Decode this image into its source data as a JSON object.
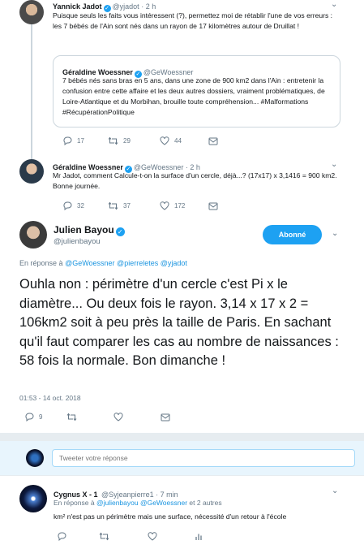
{
  "tweet1": {
    "name": "Yannick Jadot",
    "handle": "@yjadot",
    "time": "2 h",
    "text": "Puisque seuls les faits vous intéressent (?), permettez moi de rétablir l'une de vos erreurs : les 7 bébés de l'Ain sont nés dans un rayon de 17 kilomètres autour de Druillat !",
    "quote": {
      "name": "Géraldine Woessner",
      "handle": "@GeWoessner",
      "text": "7 bébés nés sans bras en 5 ans, dans une zone de 900 km2 dans l'Ain : entretenir la confusion entre cette affaire et les deux autres dossiers, vraiment problématiques, de Loire-Atlantique et du Morbihan, brouille toute compréhension... #Malformations #RécupérationPolitique"
    },
    "replies": "17",
    "retweets": "29",
    "likes": "44"
  },
  "tweet2": {
    "name": "Géraldine Woessner",
    "handle": "@GeWoessner",
    "time": "2 h",
    "text": "Mr Jadot, comment Calcule-t-on la surface d'un cercle, déjà...? (17x17) x 3,1416 = 900 km2. Bonne journée.",
    "replies": "32",
    "retweets": "37",
    "likes": "172"
  },
  "main": {
    "name": "Julien Bayou",
    "handle": "@julienbayou",
    "follow_label": "Abonné",
    "reply_prefix": "En réponse à",
    "reply_to": "@GeWoessner @pierreletes @yjadot",
    "text": "Ouhla non : périmètre d'un cercle c'est Pi x le diamètre... Ou deux fois le rayon. 3,14 x 17 x 2 = 106km2 soit à peu près la taille de Paris. En sachant qu'il faut comparer les cas au nombre de naissances : 58 fois la normale. Bon dimanche !",
    "timestamp": "01:53 - 14 oct. 2018",
    "replies": "9"
  },
  "compose": {
    "placeholder": "Tweeter votre réponse"
  },
  "tweet3": {
    "name": "Cygnus X - 1",
    "handle": "@Syjeanpierre1",
    "time": "7 min",
    "reply_prefix": "En réponse à",
    "reply_to": "@julienbayou @GeWoessner",
    "reply_suffix": "et 2 autres",
    "text": "km² n'est pas un périmètre mais une surface, nécessité d'un retour à l'école"
  },
  "colors": {
    "accent": "#1da1f2",
    "link": "#1b95e0",
    "muted": "#657786",
    "divider": "#e6ecf0"
  }
}
